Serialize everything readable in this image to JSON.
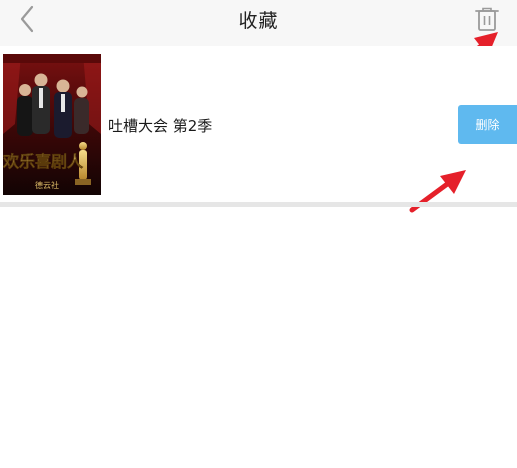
{
  "header": {
    "title": "收藏",
    "back_icon": "chevron-left-icon",
    "delete_all_icon": "trash-icon"
  },
  "favorites": [
    {
      "title": "吐槽大会 第2季",
      "poster": {
        "title_text": "欢乐喜剧人",
        "subtitle_text": "德云社"
      },
      "delete_label": "删除"
    }
  ],
  "colors": {
    "header_bg": "#f7f7f7",
    "delete_button": "#5fb9ef",
    "annotation_arrow": "#e5202a",
    "separator": "#e6e6e6"
  }
}
